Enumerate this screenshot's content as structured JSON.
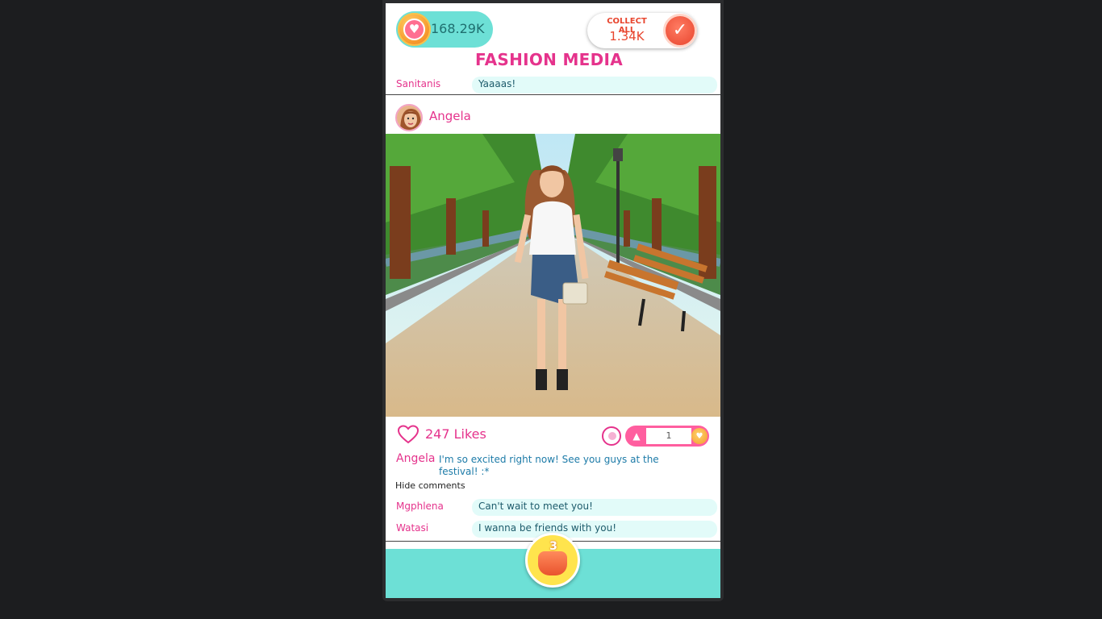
{
  "header": {
    "hearts_value": "168.29K",
    "collect_label": "COLLECT ALL",
    "collect_value": "1.34K",
    "title": "FASHION MEDIA"
  },
  "previous_comment": {
    "user": "Sanitanis",
    "text": "Yaaaas!"
  },
  "post": {
    "author": "Angela",
    "likes": "247 Likes",
    "boost_value": "1",
    "caption_user": "Angela",
    "caption_text": "I'm so excited right now! See you guys at the festival! :*",
    "hide_comments_label": "Hide comments",
    "comments": [
      {
        "user": "Mgphlena",
        "text": "Can't wait to meet you!"
      },
      {
        "user": "Watasi",
        "text": "I wanna be friends with you!"
      }
    ]
  },
  "bottom": {
    "bag_count": "3"
  },
  "colors": {
    "accent_pink": "#e5338c",
    "teal": "#6de0d6",
    "orange": "#e8452e"
  },
  "icons": [
    "heart-coin-icon",
    "checkmark-icon",
    "heart-outline-icon",
    "boost-icon",
    "arrow-up-icon",
    "shopping-bag-icon"
  ]
}
